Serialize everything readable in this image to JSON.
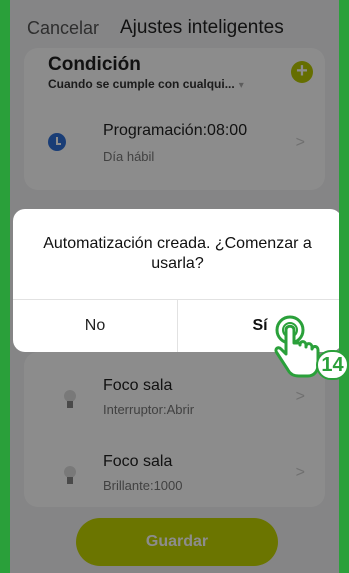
{
  "header": {
    "cancel_label": "Cancelar",
    "title": "Ajustes inteligentes"
  },
  "condition": {
    "title": "Condición",
    "subtitle": "Cuando se cumple con cualqui...",
    "caret": "▾",
    "add_label": "+",
    "schedule": {
      "title": "Programación:08:00",
      "subtitle": "Día hábil"
    }
  },
  "actions": [
    {
      "title": "Foco sala",
      "subtitle": "Interruptor:Abrir"
    },
    {
      "title": "Foco sala",
      "subtitle": "Brillante:1000"
    }
  ],
  "chevron": ">",
  "save_label": "Guardar",
  "dialog": {
    "message": "Automatización creada. ¿Comenzar a usarla?",
    "no_label": "No",
    "yes_label": "Sí"
  },
  "step_number": "14",
  "colors": {
    "accent": "#c3d600",
    "frame": "#2aa03a",
    "clock": "#2f6fd8"
  }
}
